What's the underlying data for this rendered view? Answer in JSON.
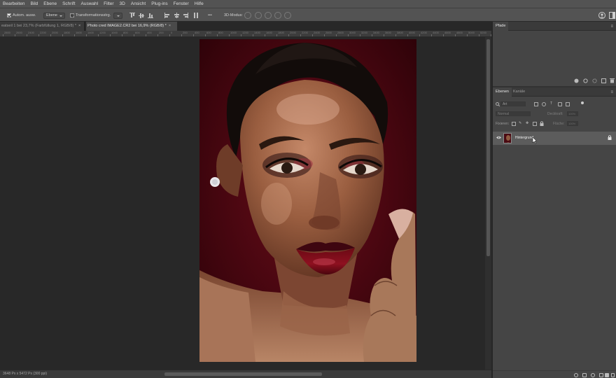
{
  "menu": [
    "Bearbeiten",
    "Bild",
    "Ebene",
    "Schrift",
    "Auswahl",
    "Filter",
    "3D",
    "Ansicht",
    "Plug-ins",
    "Fenster",
    "Hilfe"
  ],
  "options": {
    "auto_select_label": "Autom. ausw.",
    "auto_select_target": "Ebene",
    "transform_controls_label": "Transformationsstrg.",
    "mode_3d_label": "3D-Modus:",
    "more": "•••"
  },
  "tabs": [
    {
      "label": "eatseil 1 bei 23,7% (Farbfüllung 1, RGB/8) *",
      "active": false,
      "close": "×"
    },
    {
      "label": "Photo cred IMAGE2.CR2 bei 16,9% (RGB/8) *",
      "active": true,
      "close": "×"
    }
  ],
  "ruler": {
    "labels": [
      "2800",
      "2600",
      "2400",
      "2200",
      "2000",
      "1800",
      "1600",
      "1400",
      "1200",
      "1000",
      "800",
      "600",
      "400",
      "200",
      "0",
      "200",
      "400",
      "600",
      "800",
      "1000",
      "1200",
      "1400",
      "1600",
      "1800",
      "2000",
      "2200",
      "2400",
      "2600",
      "2800",
      "3000",
      "3200",
      "3400",
      "3600",
      "3800",
      "4000",
      "4200",
      "4400",
      "4600",
      "4800",
      "5000",
      "5200",
      "5400"
    ]
  },
  "status": {
    "text": "3648 Px x 5472 Px (300 ppi)"
  },
  "photo_panel": {
    "title": "Pfade"
  },
  "layers_panel": {
    "tabs": [
      "Ebenen",
      "Kanäle"
    ],
    "filter_label": "Art",
    "blend_mode": "Normal",
    "opacity_label": "Deckkraft:",
    "opacity_value": "100%",
    "lock_label": "Fixieren:",
    "fill_label": "Fläche:",
    "fill_value": "100%",
    "layers": [
      {
        "name": "Hintergrund",
        "visible": true,
        "locked": true
      }
    ]
  },
  "colors": {
    "accent": "#4a0712",
    "panel": "#454545",
    "canvas": "#282828"
  }
}
